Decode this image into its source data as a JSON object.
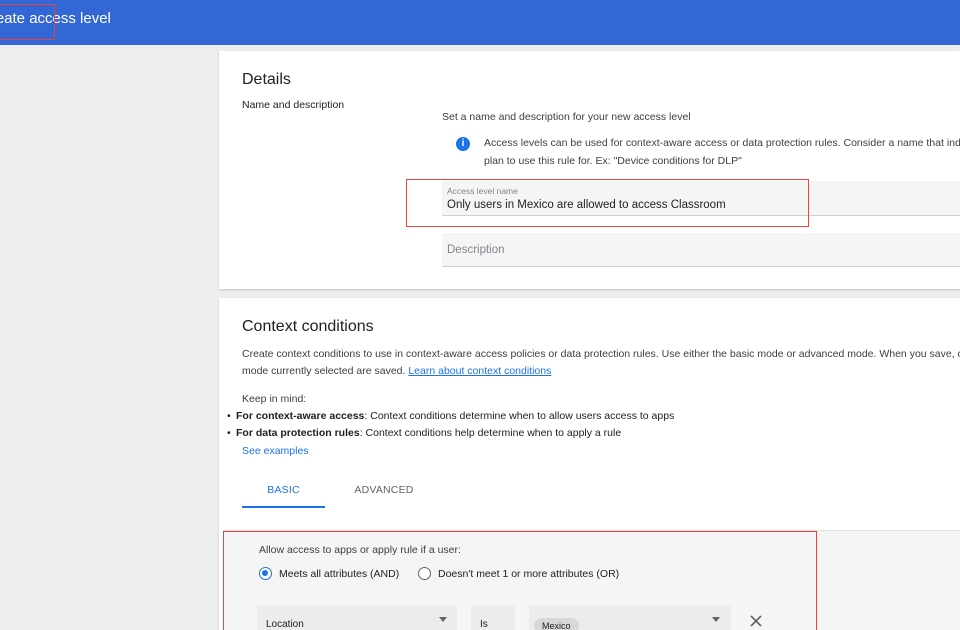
{
  "header": {
    "title": "Create access level"
  },
  "details": {
    "heading": "Details",
    "subheading": "Name and description",
    "intro": "Set a name and description for your new access level",
    "info_line1": "Access levels can be used for context-aware access or data protection rules. Consider a name that indicates",
    "info_line2": "plan to use this rule for. Ex: \"Device conditions for DLP\"",
    "name_label": "Access level name",
    "name_value": "Only users in Mexico are allowed to access Classroom",
    "description_placeholder": "Description"
  },
  "context": {
    "heading": "Context conditions",
    "desc_line1": "Create context conditions to use in context-aware access policies or data protection rules. Use either the basic mode or advanced mode. When you save, only con",
    "desc_line2": "mode currently selected are saved.",
    "learn_link": "Learn about context conditions",
    "keep_in_mind": "Keep in mind:",
    "bullets": [
      {
        "bold": "For context-aware access",
        "text": ": Context conditions determine when to allow users access to apps"
      },
      {
        "bold": "For data protection rules",
        "text": ": Context conditions help determine when to apply a rule"
      }
    ],
    "see_examples": "See examples",
    "tabs": [
      {
        "label": "BASIC"
      },
      {
        "label": "ADVANCED"
      }
    ],
    "allow_text": "Allow access to apps or apply rule if a user:",
    "radio_and": "Meets all attributes (AND)",
    "radio_or": "Doesn't meet 1 or more attributes (OR)",
    "condition": {
      "attribute": "Location",
      "operator": "Is",
      "value_chip": "Mexico"
    }
  },
  "colors": {
    "accent": "#1a73e8",
    "topbar": "#3367d6",
    "highlight": "#e8453c"
  }
}
